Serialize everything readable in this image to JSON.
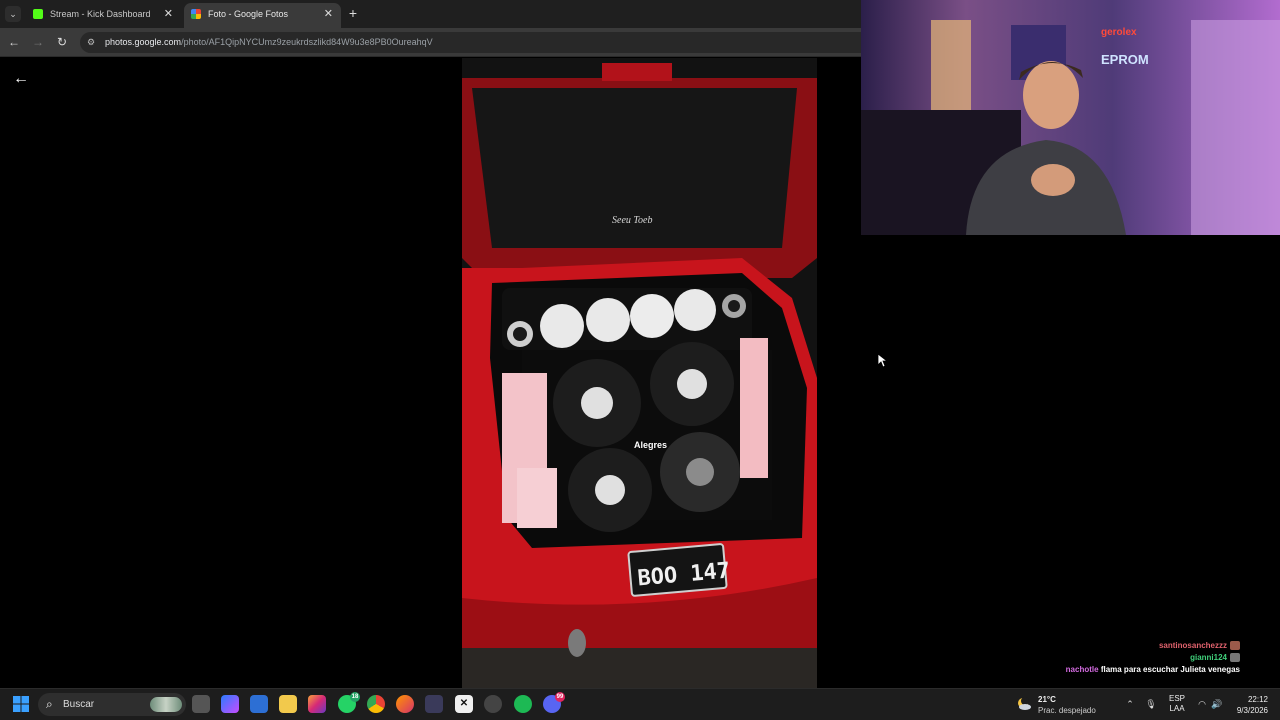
{
  "browser": {
    "tabs": [
      {
        "title": "Stream - Kick Dashboard",
        "favicon_color": "#53fc18",
        "active": false
      },
      {
        "title": "Foto - Google Fotos",
        "favicon_color": "#fbbc04",
        "active": true
      }
    ],
    "new_tab_symbol": "+",
    "close_symbol": "✕",
    "url_host": "photos.google.com",
    "url_path": "/photo/AF1QipNYCUmz9zeukrdszlikd84W9u3e8PB0OureahqV"
  },
  "photo": {
    "plate": "BOO 147",
    "sticker": "Alegres",
    "car_color": "#c8141c"
  },
  "overlay": {
    "webcam_sign_1": "gerolex",
    "webcam_sign_2": "EPROM"
  },
  "chat": [
    {
      "user": "santinosanchezzz",
      "user_color": "#e0626d",
      "message": "",
      "emote_color": "#9b5a4a"
    },
    {
      "user": "gianni124",
      "user_color": "#3fd07a",
      "message": "",
      "emote_color": "#777777"
    },
    {
      "user": "nachotle",
      "user_color": "#d36be0",
      "message": "flama para escuchar Julieta venegas",
      "emote_color": ""
    }
  ],
  "taskbar": {
    "search_placeholder": "Buscar",
    "weather_temp": "21°C",
    "weather_desc": "Prac. despejado",
    "lang_1": "ESP",
    "lang_2": "LAA",
    "time": "22:12",
    "date": "9/3/2026",
    "whatsapp_badge": "18",
    "discord_badge": "99"
  }
}
